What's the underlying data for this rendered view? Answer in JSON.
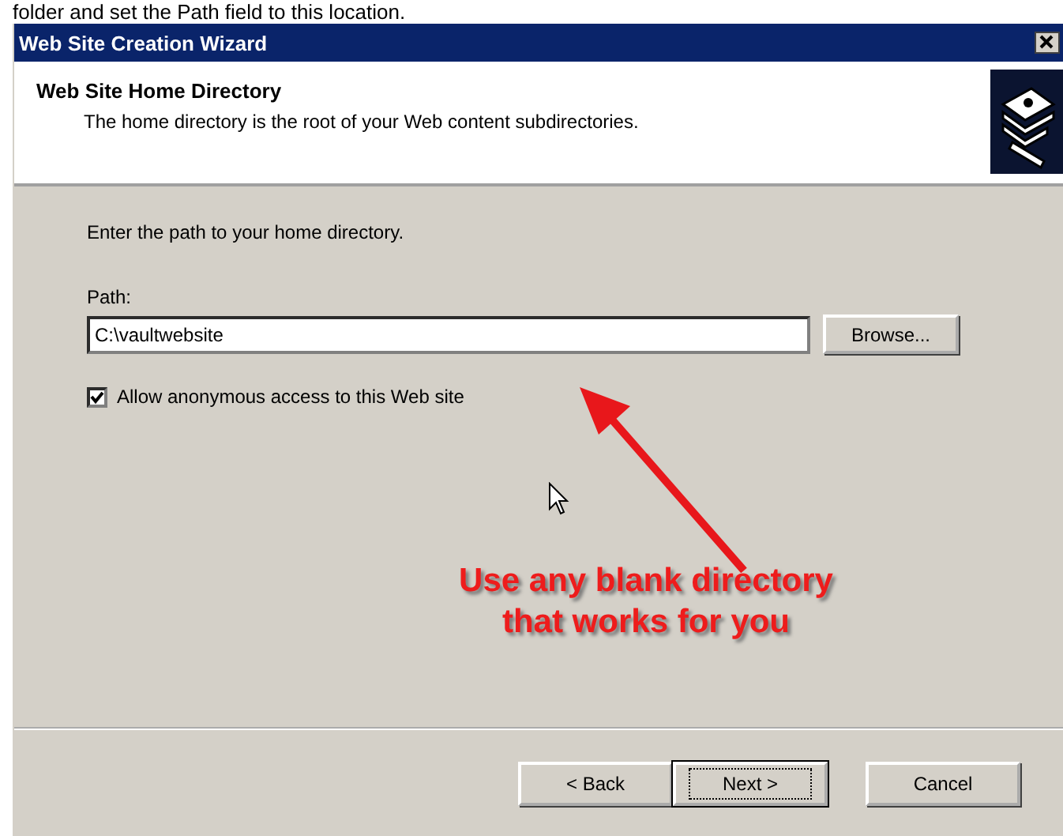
{
  "caption": "folder and set the Path field to this location.",
  "window": {
    "title": "Web Site Creation Wizard"
  },
  "header": {
    "title": "Web Site Home Directory",
    "subtitle": "The home directory is the root of your Web content subdirectories."
  },
  "instruction": "Enter the path to your home directory.",
  "path": {
    "label": "Path:",
    "value": "C:\\vaultwebsite",
    "browse": "Browse..."
  },
  "anonymous": {
    "label": "Allow anonymous access to this Web site",
    "checked": true
  },
  "annotation": [
    "Use any blank directory",
    "that works for you"
  ],
  "buttons": [
    {
      "label": "< Back",
      "default": false
    },
    {
      "label": "Next >",
      "default": true
    },
    {
      "label": "Cancel",
      "default": false
    }
  ]
}
